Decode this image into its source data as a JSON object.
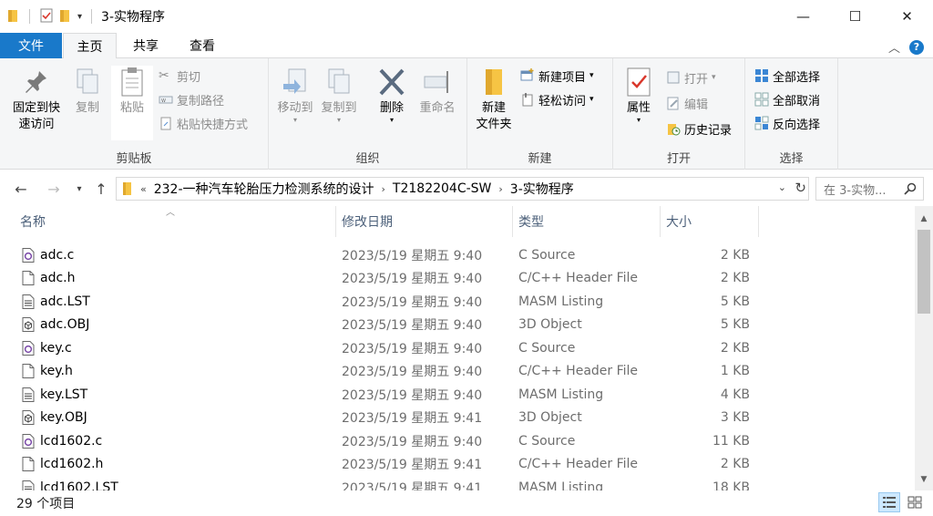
{
  "window": {
    "title": "3-实物程序",
    "minimize": "—",
    "maximize": "☐",
    "close": "✕"
  },
  "ribbon_tabs": {
    "file": "文件",
    "home": "主页",
    "share": "共享",
    "view": "查看"
  },
  "ribbon": {
    "clipboard": {
      "label": "剪贴板",
      "pin": "固定到快\n速访问",
      "pin_l1": "固定到快",
      "pin_l2": "速访问",
      "copy": "复制",
      "paste": "粘贴",
      "cut": "剪切",
      "copy_path": "复制路径",
      "paste_shortcut": "粘贴快捷方式"
    },
    "organize": {
      "label": "组织",
      "move_to": "移动到",
      "copy_to": "复制到",
      "delete": "删除",
      "rename": "重命名"
    },
    "new": {
      "label": "新建",
      "new_folder_l1": "新建",
      "new_folder_l2": "文件夹",
      "new_item": "新建项目",
      "easy_access": "轻松访问"
    },
    "open": {
      "label": "打开",
      "properties": "属性",
      "open": "打开",
      "edit": "编辑",
      "history": "历史记录"
    },
    "select": {
      "label": "选择",
      "select_all": "全部选择",
      "select_none": "全部取消",
      "invert": "反向选择"
    }
  },
  "address": {
    "overflow": "«",
    "crumbs": [
      "232-一种汽车轮胎压力检测系统的设计",
      "T2182204C-SW",
      "3-实物程序"
    ],
    "search_placeholder": "在 3-实物..."
  },
  "columns": {
    "name": "名称",
    "date": "修改日期",
    "type": "类型",
    "size": "大小"
  },
  "files": [
    {
      "name": "adc.c",
      "date": "2023/5/19 星期五 9:40",
      "type": "C Source",
      "size": "2 KB",
      "icon": "c-source-icon"
    },
    {
      "name": "adc.h",
      "date": "2023/5/19 星期五 9:40",
      "type": "C/C++ Header File",
      "size": "2 KB",
      "icon": "blank-file-icon"
    },
    {
      "name": "adc.LST",
      "date": "2023/5/19 星期五 9:40",
      "type": "MASM Listing",
      "size": "5 KB",
      "icon": "text-file-icon"
    },
    {
      "name": "adc.OBJ",
      "date": "2023/5/19 星期五 9:40",
      "type": "3D Object",
      "size": "5 KB",
      "icon": "3d-object-icon"
    },
    {
      "name": "key.c",
      "date": "2023/5/19 星期五 9:40",
      "type": "C Source",
      "size": "2 KB",
      "icon": "c-source-icon"
    },
    {
      "name": "key.h",
      "date": "2023/5/19 星期五 9:40",
      "type": "C/C++ Header File",
      "size": "1 KB",
      "icon": "blank-file-icon"
    },
    {
      "name": "key.LST",
      "date": "2023/5/19 星期五 9:40",
      "type": "MASM Listing",
      "size": "4 KB",
      "icon": "text-file-icon"
    },
    {
      "name": "key.OBJ",
      "date": "2023/5/19 星期五 9:41",
      "type": "3D Object",
      "size": "3 KB",
      "icon": "3d-object-icon"
    },
    {
      "name": "lcd1602.c",
      "date": "2023/5/19 星期五 9:40",
      "type": "C Source",
      "size": "11 KB",
      "icon": "c-source-icon"
    },
    {
      "name": "lcd1602.h",
      "date": "2023/5/19 星期五 9:41",
      "type": "C/C++ Header File",
      "size": "2 KB",
      "icon": "blank-file-icon"
    },
    {
      "name": "lcd1602.LST",
      "date": "2023/5/19 星期五 9:41",
      "type": "MASM Listing",
      "size": "18 KB",
      "icon": "text-file-icon"
    }
  ],
  "status": {
    "count": "29 个项目"
  },
  "colors": {
    "accent": "#1979ca",
    "ribbon_bg": "#f5f6f7",
    "header_text": "#4c607a",
    "folder": "#f6c444"
  }
}
